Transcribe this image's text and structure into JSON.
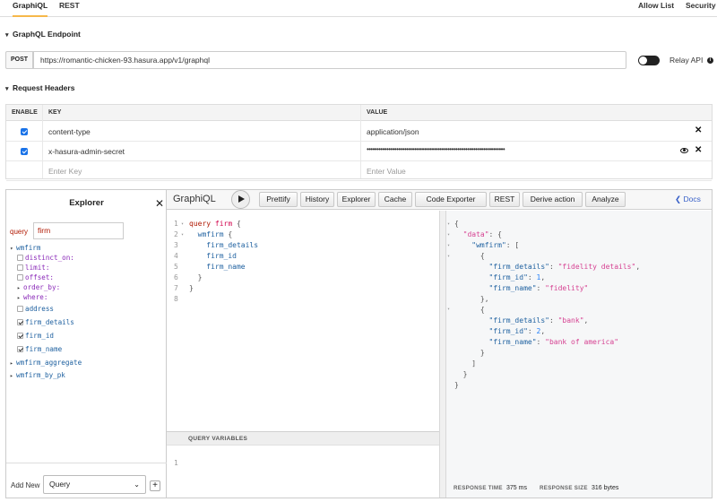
{
  "topnav": {
    "tabs": [
      "GraphiQL",
      "REST"
    ],
    "right_links": [
      "Allow List",
      "Security"
    ]
  },
  "endpoint": {
    "title": "GraphQL Endpoint",
    "method": "POST",
    "url": "https://romantic-chicken-93.hasura.app/v1/graphql",
    "relay_label": "Relay API",
    "relay_enabled": false
  },
  "request_headers": {
    "title": "Request Headers",
    "columns": {
      "enable": "ENABLE",
      "key": "KEY",
      "value": "VALUE"
    },
    "rows": [
      {
        "enabled": true,
        "key": "content-type",
        "value": "application/json"
      },
      {
        "enabled": true,
        "key": "x-hasura-admin-secret",
        "value": "••••••••••••••••••••••••••••••••••••••••••••••••••••••••••••••••••••••"
      }
    ],
    "new_row": {
      "key_placeholder": "Enter Key",
      "value_placeholder": "Enter Value"
    }
  },
  "explorer": {
    "title": "Explorer",
    "query_keyword": "query",
    "query_name": "firm",
    "tree": {
      "root": "wmfirm",
      "args": [
        "distinct_on:",
        "limit:",
        "offset:",
        "order_by:",
        "where:"
      ],
      "fields": [
        {
          "name": "address",
          "checked": false
        },
        {
          "name": "firm_details",
          "checked": true
        },
        {
          "name": "firm_id",
          "checked": true
        },
        {
          "name": "firm_name",
          "checked": true
        }
      ],
      "other_roots": [
        "wmfirm_aggregate",
        "wmfirm_by_pk"
      ]
    },
    "add_new_label": "Add New",
    "add_new_value": "Query",
    "add_button": "+"
  },
  "toolbar": {
    "title": "GraphiQL",
    "buttons": [
      "Prettify",
      "History",
      "Explorer",
      "Cache",
      "Code Exporter",
      "REST",
      "Derive action",
      "Analyze"
    ],
    "docs": "Docs"
  },
  "editor": {
    "line_numbers": [
      "1",
      "2",
      "3",
      "4",
      "5",
      "6",
      "7",
      "8"
    ],
    "query_keyword": "query",
    "operation_name": "firm",
    "root_field": "wmfirm",
    "fields": [
      "firm_details",
      "firm_id",
      "firm_name"
    ],
    "vars_title": "QUERY VARIABLES",
    "vars_line": "1"
  },
  "result": {
    "data_key": "\"data\"",
    "root_key": "\"wmfirm\"",
    "rows": [
      {
        "firm_details": "\"fidelity details\"",
        "firm_id": "1",
        "firm_name": "\"fidelity\""
      },
      {
        "firm_details": "\"bank\"",
        "firm_id": "2",
        "firm_name": "\"bank of america\""
      }
    ],
    "keys": {
      "firm_details": "\"firm_details\"",
      "firm_id": "\"firm_id\"",
      "firm_name": "\"firm_name\""
    },
    "response_time_label": "RESPONSE TIME",
    "response_time": "375 ms",
    "response_size_label": "RESPONSE SIZE",
    "response_size": "316 bytes"
  }
}
